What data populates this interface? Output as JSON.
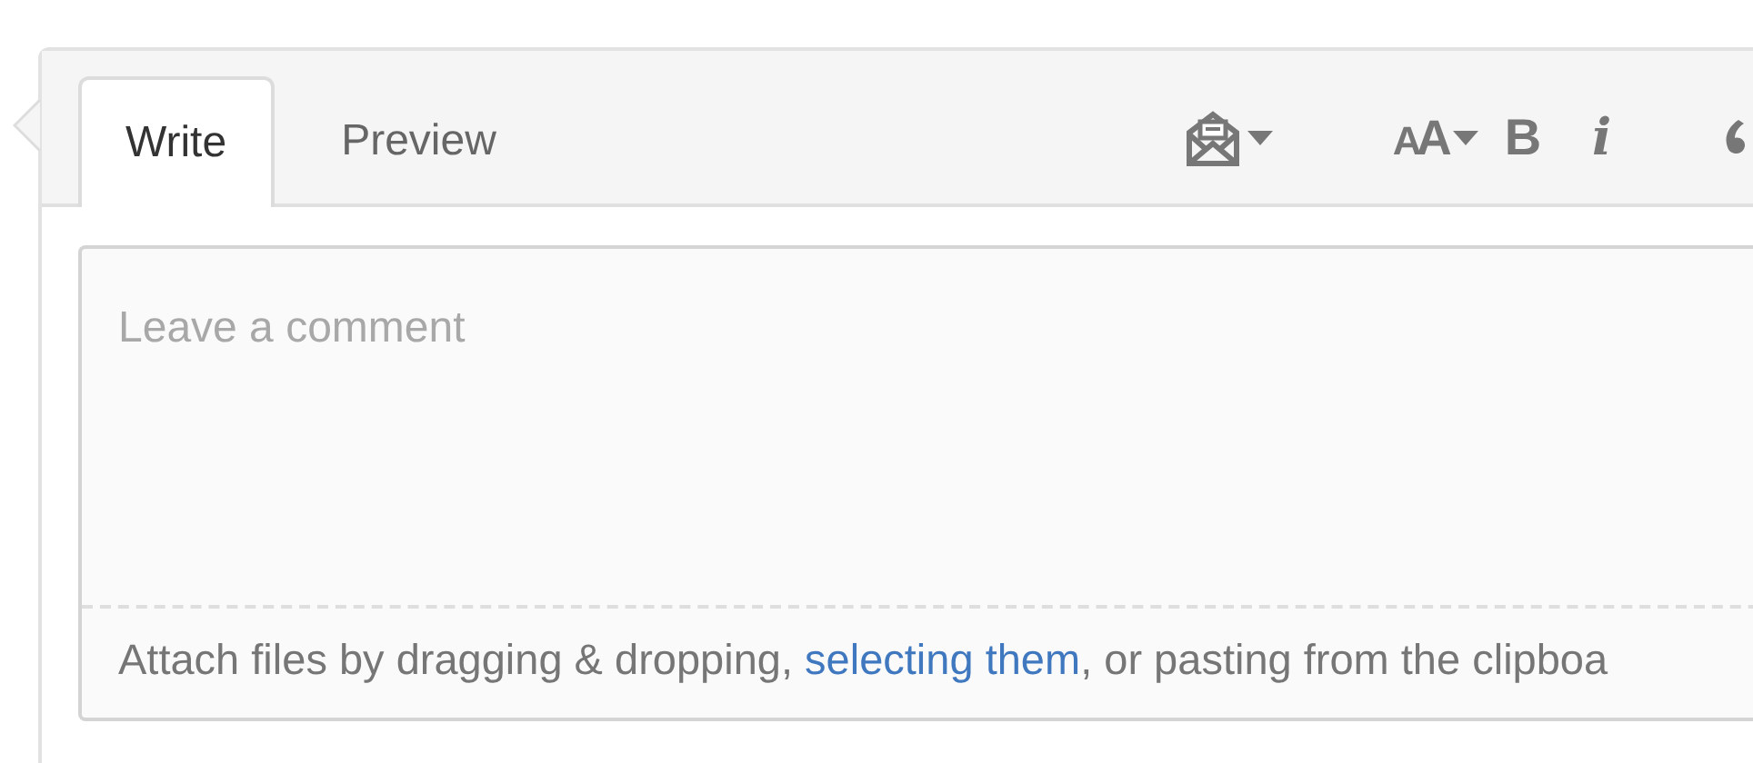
{
  "tabs": [
    {
      "label": "Write",
      "selected": true
    },
    {
      "label": "Preview",
      "selected": false
    }
  ],
  "toolbar": [
    {
      "kind": "mention"
    },
    {
      "kind": "header",
      "label": "AA"
    },
    {
      "kind": "bold",
      "label": "B"
    },
    {
      "kind": "italic",
      "label": "i"
    },
    {
      "kind": "quote"
    }
  ],
  "comment": {
    "placeholder": "Leave a comment"
  },
  "attach_hint": {
    "before": "Attach files by dragging & dropping, ",
    "link": "selecting them",
    "after": ", or pasting from the clipboa"
  }
}
